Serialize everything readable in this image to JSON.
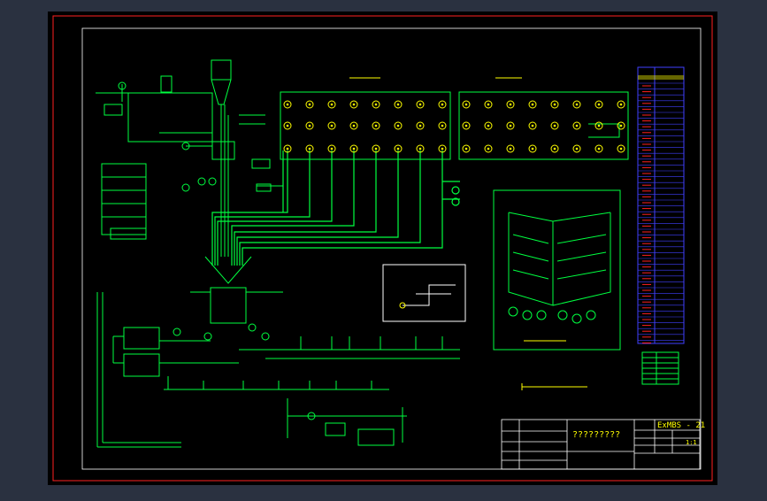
{
  "colors": {
    "background": "#2a3140",
    "sheet": "#000000",
    "border": "#ff2020",
    "wire": "#00ff40",
    "fixture": "#ffff00",
    "legend": "#4040ff",
    "pipe": "#00c0ff",
    "white": "#ffffff"
  },
  "drawing": {
    "code": "ExMBS - 21",
    "title_text": "?????????",
    "scale": "1:1"
  }
}
